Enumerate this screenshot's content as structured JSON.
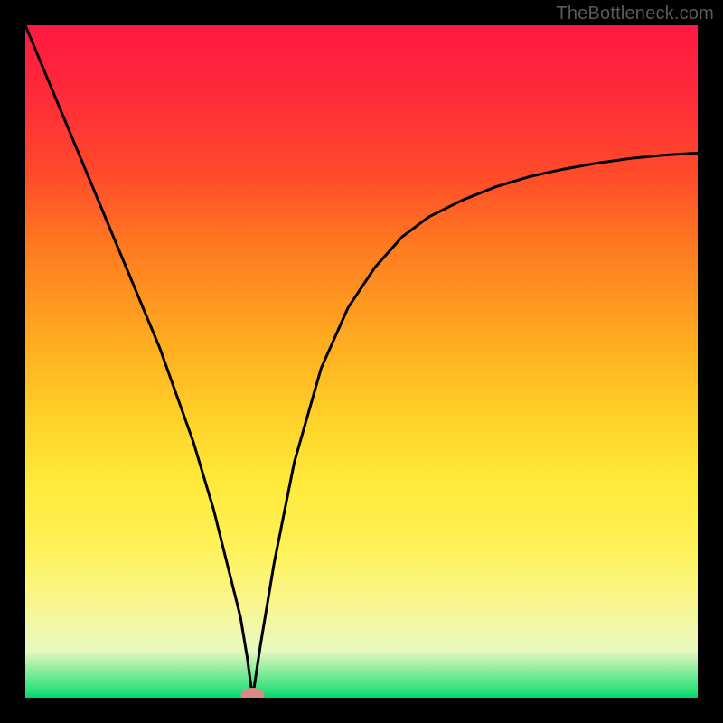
{
  "watermark": "TheBottleneck.com",
  "chart_data": {
    "type": "line",
    "title": "",
    "xlabel": "",
    "ylabel": "",
    "xlim": [
      0,
      100
    ],
    "ylim": [
      0,
      100
    ],
    "series": [
      {
        "name": "bottleneck-curve",
        "x": [
          0,
          5,
          10,
          15,
          20,
          25,
          28,
          30,
          32,
          33,
          33.8,
          35,
          37,
          40,
          44,
          48,
          52,
          56,
          60,
          65,
          70,
          75,
          80,
          85,
          90,
          95,
          100
        ],
        "values": [
          100,
          88,
          76,
          64,
          52,
          38,
          28,
          20,
          12,
          6,
          0,
          8,
          20,
          35,
          49,
          58,
          64,
          68.5,
          71.5,
          74,
          76,
          77.5,
          78.6,
          79.5,
          80.2,
          80.7,
          81
        ]
      }
    ],
    "markers": [
      {
        "name": "optimum-point",
        "x": 33.8,
        "y": 0
      }
    ]
  }
}
